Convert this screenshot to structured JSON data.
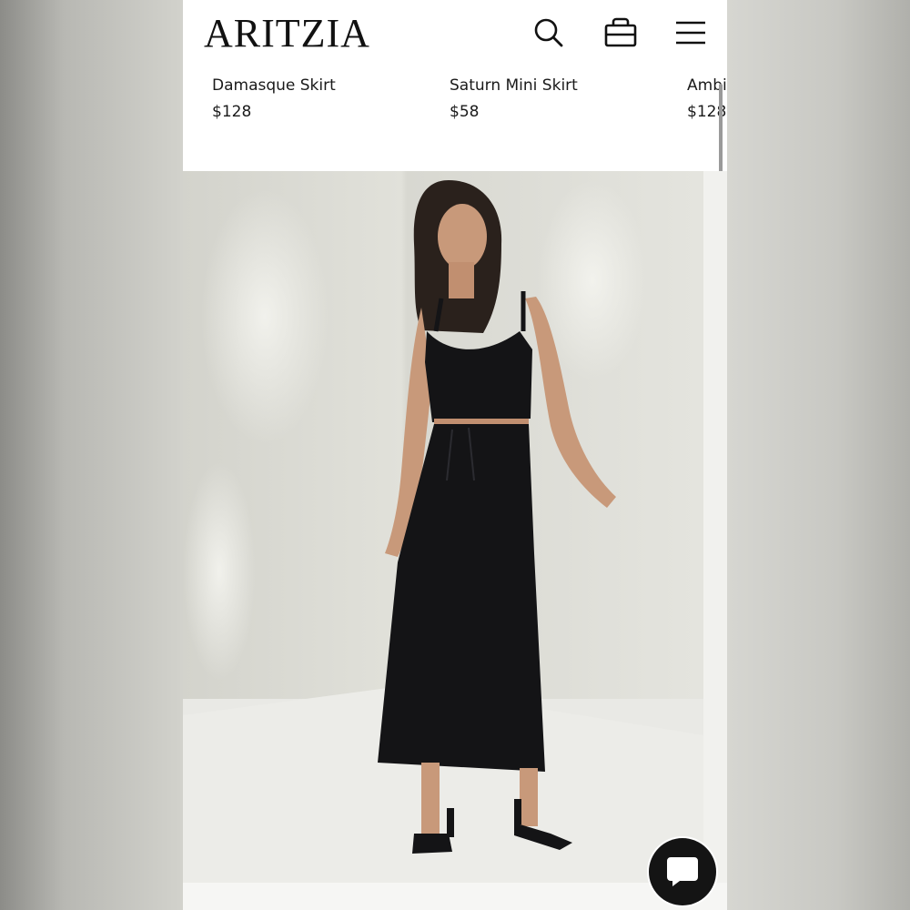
{
  "brand": {
    "logo": "ARITZIA"
  },
  "header": {
    "icons": [
      "search-icon",
      "shopping-bag-icon",
      "menu-icon"
    ]
  },
  "products": [
    {
      "name": "Damasque Skirt",
      "price": "$128"
    },
    {
      "name": "Saturn Mini Skirt",
      "price": "$58"
    },
    {
      "name": "Ambi",
      "price": "$128"
    }
  ],
  "chat": {
    "icon": "chat-bubble-icon"
  },
  "colors": {
    "brand_text": "#111111",
    "chat_button": "#141414"
  }
}
